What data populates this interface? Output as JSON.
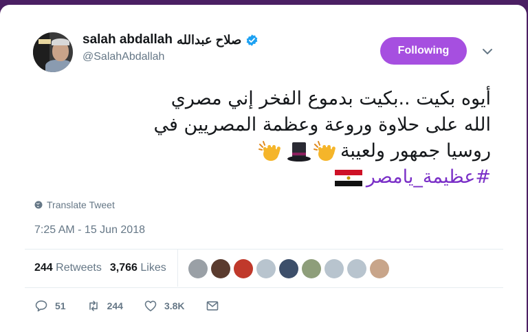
{
  "user": {
    "display_name_en": "salah abdallah",
    "display_name_ar": "صلاح عبدالله",
    "handle": "@SalahAbdallah",
    "verified": true,
    "avatar_icon": "profile-photo"
  },
  "follow_button": {
    "label": "Following",
    "color": "#a64fe0"
  },
  "tweet": {
    "line1": "أيوه بكيت ..بكيت بدموع الفخر إني مصري",
    "line2": "الله على حلاوة وروعة وعظمة المصريين في",
    "line3_text": "روسيا جمهور ولعيبة",
    "line3_emojis": [
      "clapping-hands-emoji",
      "top-hat-emoji",
      "clapping-hands-emoji"
    ],
    "hashtag": "#عظيمة_يامصر",
    "hashtag_color": "#7a2fc7",
    "flag_emoji": "egypt-flag-emoji"
  },
  "translate": {
    "label": "Translate Tweet",
    "icon": "globe-icon"
  },
  "timestamp": "7:25 AM - 15 Jun 2018",
  "stats": {
    "retweets_count": "244",
    "retweets_label": "Retweets",
    "likes_count": "3,766",
    "likes_label": "Likes"
  },
  "likers": [
    {
      "color": "#9aa0a6"
    },
    {
      "color": "#5a3b2e"
    },
    {
      "color": "#c0392b"
    },
    {
      "color": "#b8c4ce"
    },
    {
      "color": "#3d4f6a"
    },
    {
      "color": "#8e9e7a"
    },
    {
      "color": "#b8c4ce"
    },
    {
      "color": "#b8c4ce"
    },
    {
      "color": "#c8a58a"
    }
  ],
  "actions": {
    "reply": {
      "icon": "reply-icon",
      "count": "51"
    },
    "retweet": {
      "icon": "retweet-icon",
      "count": "244"
    },
    "like": {
      "icon": "heart-icon",
      "count": "3.8K"
    },
    "message": {
      "icon": "envelope-icon"
    }
  }
}
